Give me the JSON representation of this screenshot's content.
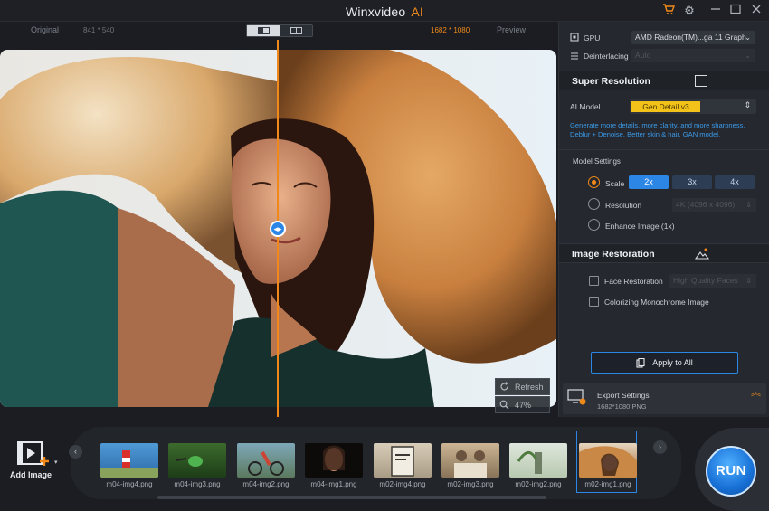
{
  "titlebar": {
    "app_name": "Winxvideo",
    "ai_suffix": "AI"
  },
  "viewbar": {
    "original_label": "Original",
    "original_res": "841 * 540",
    "output_res": "1682 * 1080",
    "preview_label": "Preview"
  },
  "preview_tools": {
    "refresh_label": "Refresh",
    "zoom_label": "47%"
  },
  "settings": {
    "gpu_label": "GPU",
    "gpu_value": "AMD Radeon(TM)...ga 11 Graph",
    "deinterlacing_label": "Deinterlacing",
    "deinterlacing_value": "Auto",
    "super_resolution": {
      "title": "Super Resolution",
      "ai_model_label": "AI Model",
      "ai_model_value": "Gen Detail v3",
      "description": "Generate more details, more clarity, and more sharpness. Deblur + Denoise. Better skin & hair. GAN model.",
      "model_settings_label": "Model Settings",
      "scale_label": "Scale",
      "scale_options": [
        "2x",
        "3x",
        "4x"
      ],
      "selected_scale": "2x",
      "resolution_label": "Resolution",
      "resolution_value": "4K (4096 x 4096)",
      "enhance_label": "Enhance Image (1x)"
    },
    "image_restoration": {
      "title": "Image Restoration",
      "face_label": "Face Restoration",
      "face_value": "High Quality Faces",
      "colorize_label": "Colorizing Monochrome Image"
    },
    "apply_label": "Apply to All",
    "export": {
      "label": "Export Settings",
      "info": "1682*1080  PNG"
    }
  },
  "add_image_label": "Add Image",
  "thumbnails": [
    "m04-img4.png",
    "m04-img3.png",
    "m04-img2.png",
    "m04-img1.png",
    "m02-img4.png",
    "m02-img3.png",
    "m02-img2.png",
    "m02-img1.png"
  ],
  "run_label": "RUN",
  "colors": {
    "accent": "#f0891a",
    "blue": "#2b86e6",
    "panel": "#25282e",
    "bg": "#1b1d22"
  }
}
